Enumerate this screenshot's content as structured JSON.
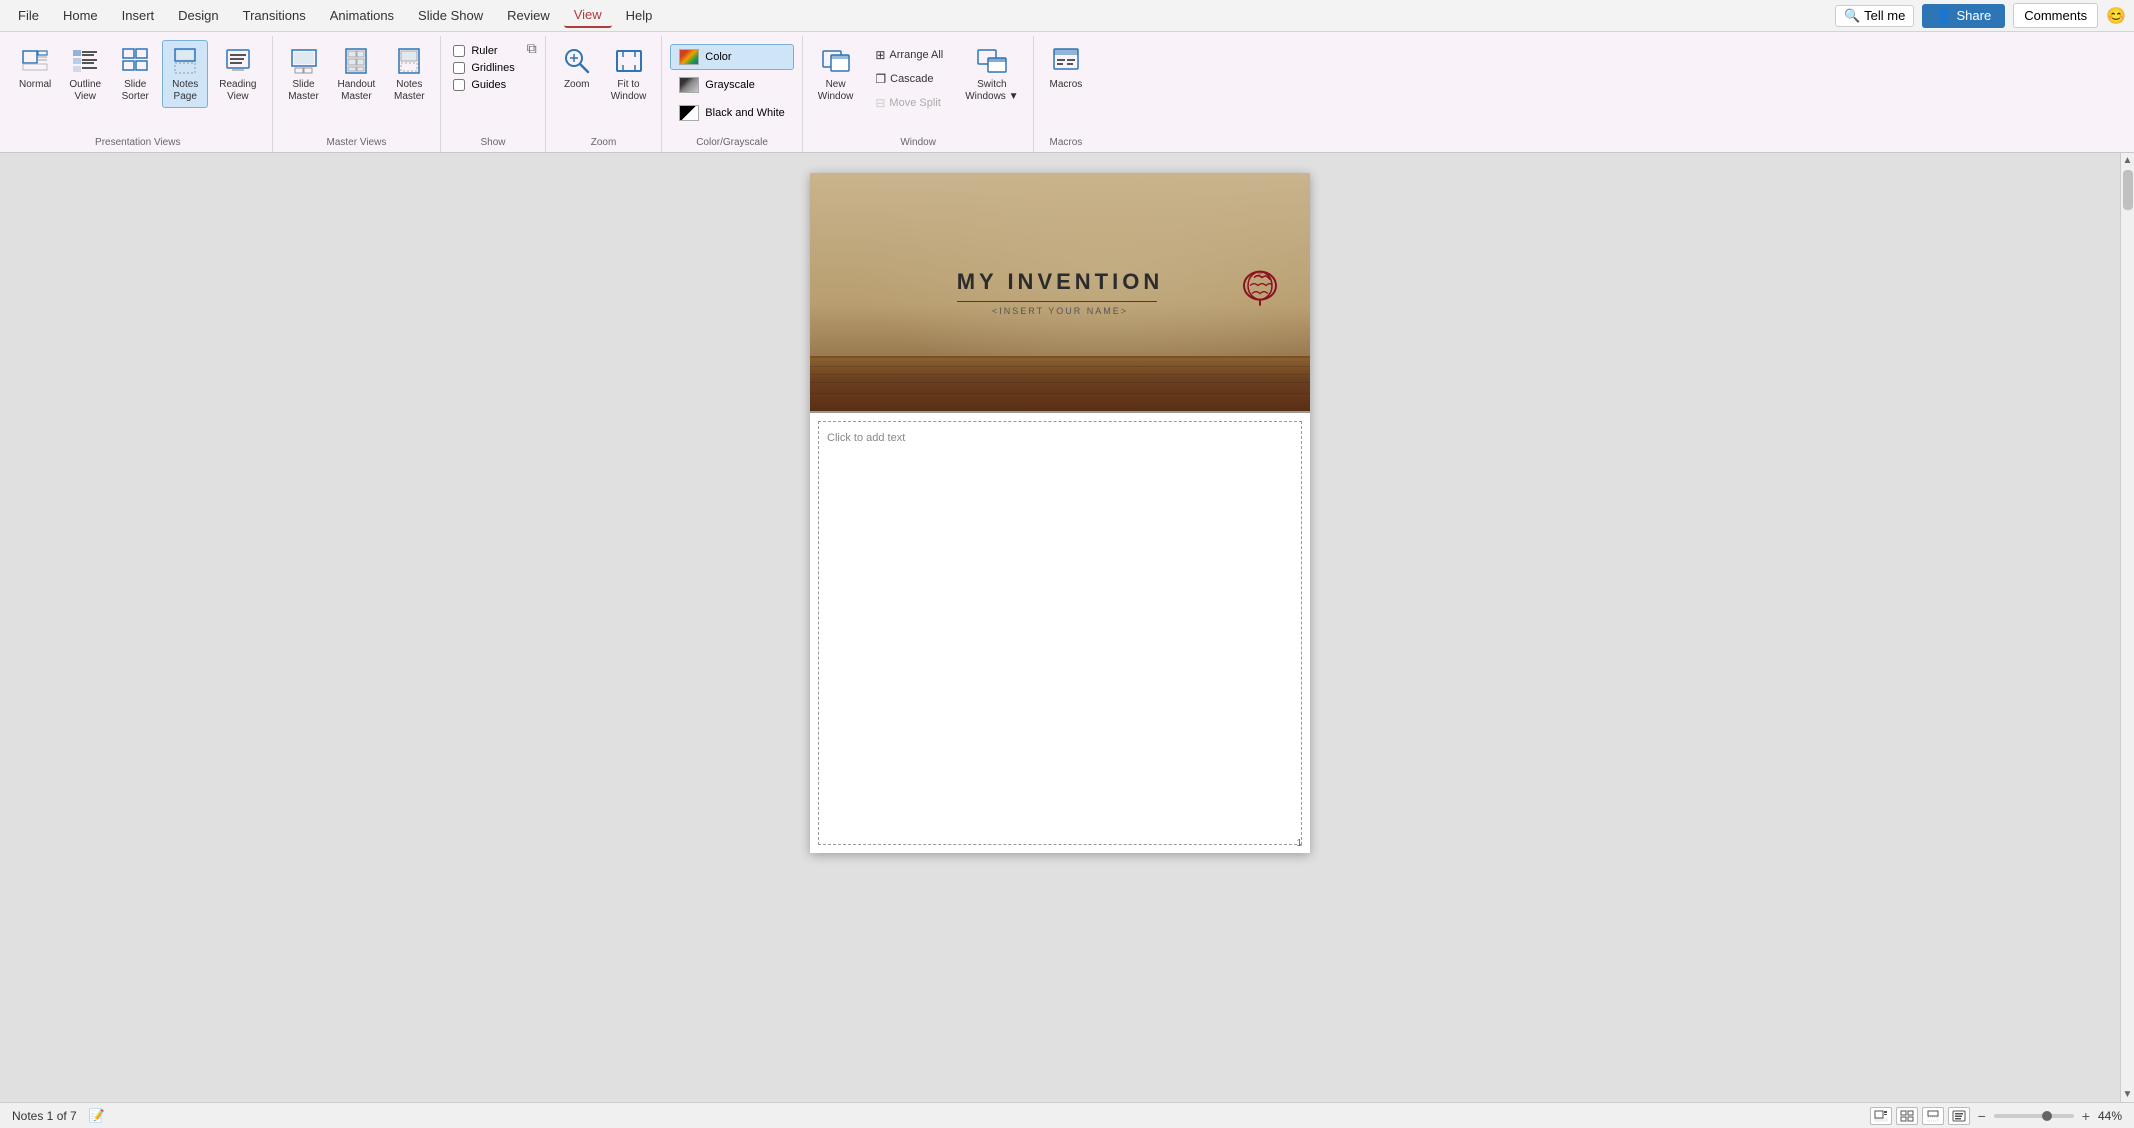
{
  "menubar": {
    "items": [
      "File",
      "Home",
      "Insert",
      "Design",
      "Transitions",
      "Animations",
      "Slide Show",
      "Review",
      "View",
      "Help"
    ],
    "active": "View",
    "search_placeholder": "Tell me",
    "share_label": "Share",
    "comments_label": "Comments"
  },
  "ribbon": {
    "groups": [
      {
        "label": "Presentation Views",
        "items": [
          {
            "id": "normal",
            "label": "Normal",
            "lines": [
              "Normal"
            ]
          },
          {
            "id": "outline-view",
            "label": "Outline View",
            "lines": [
              "Outline",
              "View"
            ]
          },
          {
            "id": "slide-sorter",
            "label": "Slide Sorter",
            "lines": [
              "Slide",
              "Sorter"
            ]
          },
          {
            "id": "notes-page",
            "label": "Notes Page",
            "lines": [
              "Notes",
              "Page"
            ],
            "active": true
          },
          {
            "id": "reading-view",
            "label": "Reading View",
            "lines": [
              "Reading",
              "View"
            ]
          }
        ]
      },
      {
        "label": "Master Views",
        "items": [
          {
            "id": "slide-master",
            "label": "Slide Master",
            "lines": [
              "Slide",
              "Master"
            ]
          },
          {
            "id": "handout-master",
            "label": "Handout Master",
            "lines": [
              "Handout",
              "Master"
            ]
          },
          {
            "id": "notes-master",
            "label": "Notes Master",
            "lines": [
              "Notes",
              "Master"
            ]
          }
        ]
      },
      {
        "label": "Show",
        "checkboxes": [
          {
            "id": "ruler",
            "label": "Ruler"
          },
          {
            "id": "gridlines",
            "label": "Gridlines"
          },
          {
            "id": "guides",
            "label": "Guides"
          }
        ]
      },
      {
        "label": "Zoom",
        "items": [
          {
            "id": "zoom",
            "label": "Zoom",
            "lines": [
              "Zoom"
            ]
          },
          {
            "id": "fit-to-window",
            "label": "Fit to Window",
            "lines": [
              "Fit to",
              "Window"
            ]
          }
        ]
      },
      {
        "label": "Color/Grayscale",
        "colorBtns": [
          {
            "id": "color",
            "label": "Color",
            "color": "#d4a020",
            "active": true
          },
          {
            "id": "grayscale",
            "label": "Grayscale",
            "color": "#888888"
          },
          {
            "id": "black-white",
            "label": "Black and White",
            "color": "#000000"
          }
        ]
      },
      {
        "label": "Window",
        "items": [
          {
            "id": "new-window",
            "label": "New Window",
            "lines": [
              "New",
              "Window"
            ]
          },
          {
            "id": "arrange-all",
            "label": "Arrange All"
          },
          {
            "id": "cascade",
            "label": "Cascade"
          },
          {
            "id": "move-split",
            "label": "Move Split",
            "disabled": true
          },
          {
            "id": "switch-windows",
            "label": "Switch Windows",
            "lines": [
              "Switch",
              "Windows"
            ],
            "hasDropdown": true
          }
        ]
      },
      {
        "label": "Macros",
        "items": [
          {
            "id": "macros",
            "label": "Macros",
            "lines": [
              "Macros"
            ]
          }
        ]
      }
    ]
  },
  "slide": {
    "title": "MY INVENTION",
    "subtitle": "<INSERT YOUR NAME>",
    "page_number": "1"
  },
  "notes": {
    "placeholder": "Click to add text"
  },
  "status_bar": {
    "notes_info": "Notes 1 of 7",
    "zoom_level": "44%",
    "zoom_value": 44
  }
}
